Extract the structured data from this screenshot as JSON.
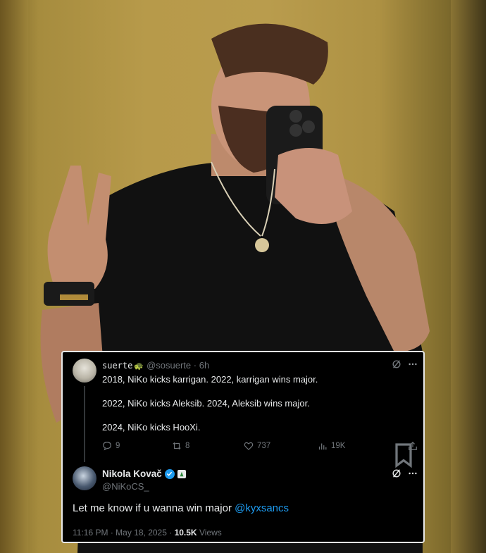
{
  "reply": {
    "display_name": "suerte",
    "emoji": "🐢",
    "handle": "@sosuerte",
    "separator": "·",
    "time": "6h",
    "lines": [
      "2018, NiKo kicks karrigan. 2022, karrigan wins major.",
      "2022, NiKo kicks Aleksib. 2024, Aleksib wins major.",
      "2024, NiKo kicks HooXi."
    ],
    "stats": {
      "replies": "9",
      "reposts": "8",
      "likes": "737",
      "views": "19K"
    }
  },
  "main": {
    "display_name": "Nikola Kovač",
    "handle": "@NiKoCS_",
    "text": "Let me know if u wanna win major ",
    "mention": "@kyxsancs",
    "time": "11:16 PM",
    "separator": "·",
    "date": "May 18, 2025",
    "views_count": "10.5K",
    "views_label": "Views"
  },
  "colors": {
    "accent": "#1d9bf0",
    "background": "#000000",
    "muted": "#71767b",
    "text": "#e7e9ea"
  },
  "icons": [
    "grok-icon",
    "more-icon",
    "reply-icon",
    "repost-icon",
    "like-icon",
    "views-icon",
    "bookmark-icon",
    "share-icon",
    "verified-icon",
    "affiliation-badge-icon"
  ]
}
